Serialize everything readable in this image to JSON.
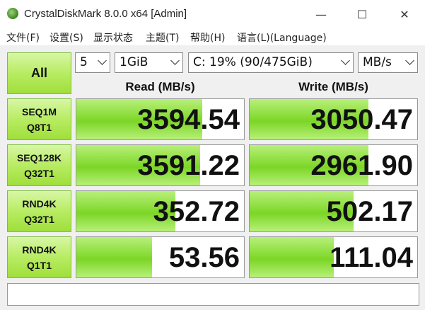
{
  "window": {
    "title": "CrystalDiskMark 8.0.0 x64 [Admin]",
    "minimize_glyph": "—",
    "maximize_glyph": "☐",
    "close_glyph": "✕",
    "icon": "crystal-disk-icon"
  },
  "menu": {
    "items": [
      "文件(F)",
      "设置(S)",
      "显示状态",
      "主题(T)",
      "帮助(H)",
      "语言(L)(Language)"
    ]
  },
  "controls": {
    "all_label": "All",
    "count": "5",
    "size": "1GiB",
    "drive": "C: 19% (90/475GiB)",
    "unit": "MB/s"
  },
  "headers": {
    "read": "Read (MB/s)",
    "write": "Write (MB/s)"
  },
  "tests": [
    {
      "line1": "SEQ1M",
      "line2": "Q8T1",
      "read": "3594.54",
      "write": "3050.47",
      "read_fill": 0.75,
      "write_fill": 0.71
    },
    {
      "line1": "SEQ128K",
      "line2": "Q32T1",
      "read": "3591.22",
      "write": "2961.90",
      "read_fill": 0.74,
      "write_fill": 0.71
    },
    {
      "line1": "RND4K",
      "line2": "Q32T1",
      "read": "352.72",
      "write": "502.17",
      "read_fill": 0.59,
      "write_fill": 0.62
    },
    {
      "line1": "RND4K",
      "line2": "Q1T1",
      "read": "53.56",
      "write": "111.04",
      "read_fill": 0.45,
      "write_fill": 0.5
    }
  ],
  "comment": "",
  "colors": {
    "accent_green": "#7cd626",
    "label_green": "#b8ec63"
  }
}
